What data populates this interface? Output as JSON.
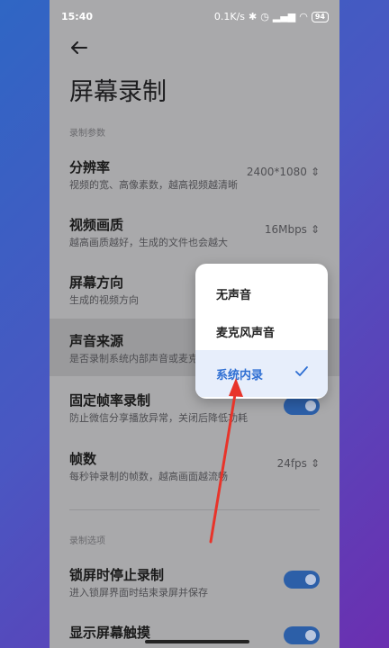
{
  "status_bar": {
    "time": "15:40",
    "net_speed": "0.1K/s",
    "battery": "94"
  },
  "page": {
    "title": "屏幕录制"
  },
  "sections": {
    "params": "录制参数",
    "options": "录制选项"
  },
  "settings": {
    "resolution": {
      "name": "分辨率",
      "desc": "视频的宽、高像素数，越高视频越清晰",
      "value": "2400*1080"
    },
    "quality": {
      "name": "视频画质",
      "desc": "越高画质越好，生成的文件也会越大",
      "value": "16Mbps"
    },
    "orientation": {
      "name": "屏幕方向",
      "desc": "生成的视频方向"
    },
    "audio_source": {
      "name": "声音来源",
      "desc": "是否录制系统内部声音或麦克风声音"
    },
    "fixed_fps": {
      "name": "固定帧率录制",
      "desc": "防止微信分享播放异常，关闭后降低功耗",
      "enabled": true
    },
    "fps": {
      "name": "帧数",
      "desc": "每秒钟录制的帧数，越高画面越流畅",
      "value": "24fps"
    },
    "lock_stop": {
      "name": "锁屏时停止录制",
      "desc": "进入锁屏界面时结束录屏并保存",
      "enabled": true
    },
    "show_touch": {
      "name": "显示屏幕触摸",
      "enabled": true
    }
  },
  "popup_menu": {
    "items": [
      "无声音",
      "麦克风声音",
      "系统内录"
    ],
    "selected_index": 2
  },
  "colors": {
    "accent": "#2f6fd3",
    "toggle_on": "#2c5fa8",
    "arrow": "#e8342a"
  }
}
